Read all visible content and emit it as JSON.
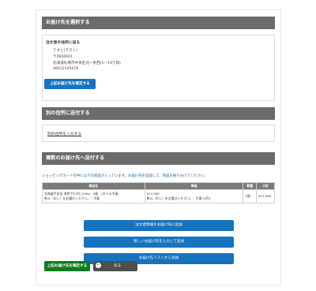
{
  "section1": {
    "header": "お届け先を選択する",
    "subtitle": "注文者の住所に送る",
    "address_lines": [
      "てすと(テスト)",
      "〒0600001",
      "北海道札幌市中央区北一条西(1〜19丁目)",
      "09012345678"
    ],
    "confirm_button": "上記お届け先を確定する"
  },
  "section2": {
    "header": "別の住所に送付する",
    "link": "別の住所を入力する"
  },
  "section3": {
    "header": "複数のお届け先へ送付する",
    "note": "ショッピングカートの中に以下の商品が入っています。お届け先を追加して、商品を振り分けてください。",
    "table": {
      "headers": [
        "商品名",
        "単価",
        "数量",
        "小計"
      ],
      "rows": [
        {
          "name": "北海道手金宝 海幸でもがに550g・2尾　(ボイル冷凍)",
          "name_sub": "熨斗（のし）をお選びください。：不要",
          "price": "¥13,500",
          "price_sub": "熨斗（のし）をお選びください。：不要 (0円)",
          "qty": "1個",
          "subtotal": "¥13,500"
        }
      ]
    },
    "buttons": [
      "注文者情報をお届け先に追加",
      "新しいお届け先を入力して追加",
      "お届け先リストから追加"
    ]
  },
  "footer": {
    "confirm_button": "上記お届け先を確定する",
    "back_button": "戻る",
    "back_icon": "arrow-left-circle-icon"
  },
  "colors": {
    "header_bg": "#6b6b6b",
    "primary_blue": "#1673be",
    "confirm_green": "#0f7a1e",
    "back_gray": "#4e4e4e"
  }
}
